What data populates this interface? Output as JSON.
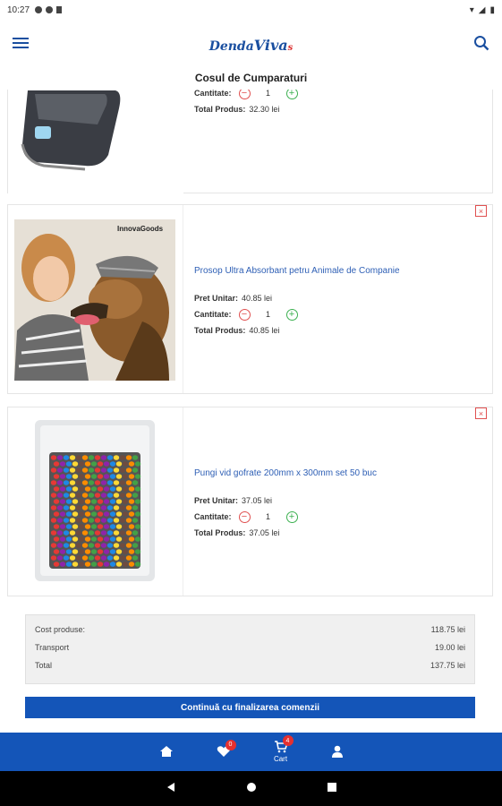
{
  "statusbar": {
    "time": "10:27"
  },
  "appbar": {
    "logo_part1": "Denda",
    "logo_part2": "Viva",
    "logo_part3": "s"
  },
  "page": {
    "title": "Cosul de Cumparaturi"
  },
  "labels": {
    "price": "Pret Unitar:",
    "qty": "Cantitate:",
    "total": "Total Produs:",
    "remove": "×"
  },
  "cart": {
    "items": [
      {
        "name": "",
        "price": "",
        "qty": "1",
        "total": "32.30 lei"
      },
      {
        "name": "Prosop Ultra Absorbant petru Animale de Companie",
        "price": "40.85 lei",
        "qty": "1",
        "total": "40.85 lei",
        "image_brand": "InnovaGoods"
      },
      {
        "name": "Pungi vid gofrate 200mm x 300mm set 50 buc",
        "price": "37.05 lei",
        "qty": "1",
        "total": "37.05 lei"
      }
    ]
  },
  "summary": {
    "products_label": "Cost produse:",
    "products_value": "118.75 lei",
    "transport_label": "Transport",
    "transport_value": "19.00 lei",
    "total_label": "Total",
    "total_value": "137.75 lei"
  },
  "checkout": {
    "label": "Continuă cu finalizarea comenzii"
  },
  "bottomnav": {
    "favorites_badge": "0",
    "cart_badge": "4",
    "cart_label": "Cart"
  },
  "colors": {
    "accent": "#1455b8",
    "minus": "#e05050",
    "plus": "#3cb050"
  },
  "icons": [
    "menu-icon",
    "search-icon",
    "home-icon",
    "heart-icon",
    "cart-icon",
    "user-icon",
    "back-icon",
    "home-circle-icon",
    "recents-icon"
  ]
}
